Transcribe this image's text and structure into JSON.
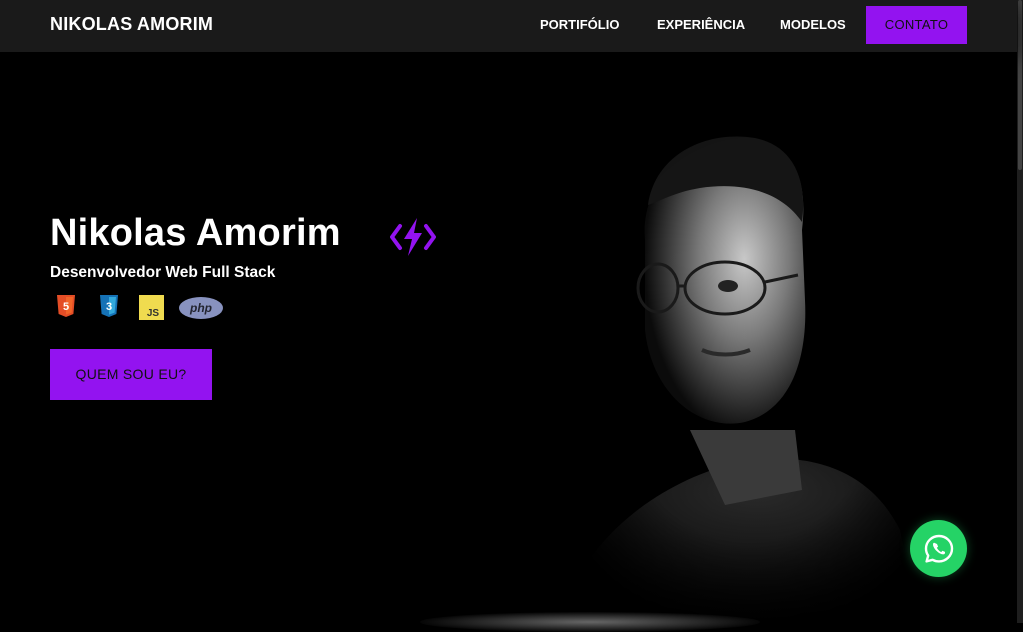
{
  "header": {
    "brand": "NIKOLAS AMORIM",
    "nav": [
      {
        "label": "PORTIFÓLIO"
      },
      {
        "label": "EXPERIÊNCIA"
      },
      {
        "label": "MODELOS"
      }
    ],
    "cta_label": "CONTATO"
  },
  "hero": {
    "title": "Nikolas Amorim",
    "subtitle": "Desenvolvedor Web Full Stack",
    "tech": {
      "html5": "5",
      "css3": "3",
      "js": "JS",
      "php": "php"
    },
    "button_label": "QUEM SOU EU?"
  },
  "colors": {
    "accent": "#9313f0",
    "navbar": "#1a1a1a",
    "background": "#000000",
    "whatsapp": "#25d366"
  },
  "icons": [
    "lightning-bolt-icon",
    "html5-icon",
    "css3-icon",
    "javascript-icon",
    "php-icon",
    "whatsapp-icon"
  ]
}
